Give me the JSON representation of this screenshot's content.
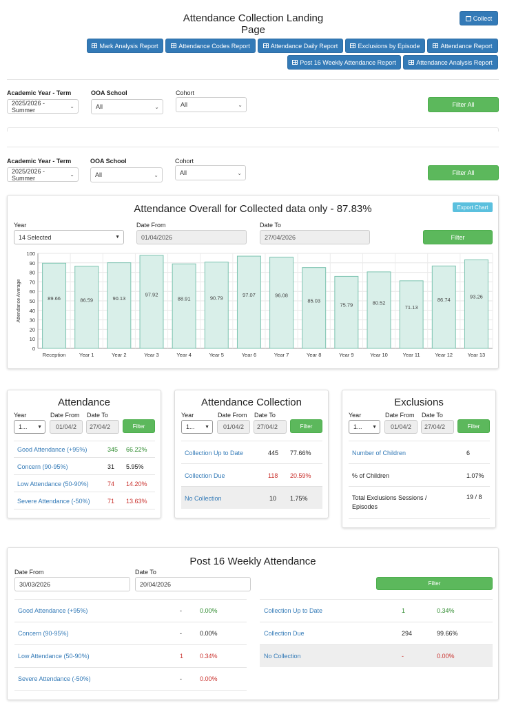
{
  "header": {
    "title_line1": "Attendance Collection Landing",
    "title_line2": "Page",
    "collect_label": "Collect",
    "reports": [
      "Mark Analysis Report",
      "Attendance Codes Report",
      "Attendance Daily Report",
      "Exclusions by Episode",
      "Attendance Report",
      "Post 16 Weekly Attendance Report",
      "Attendance Analysis Report"
    ]
  },
  "filters": [
    {
      "academic_label": "Academic Year - Term",
      "academic_value": "2025/2026 - Summer",
      "ooa_label": "OOA School",
      "ooa_value": "All",
      "cohort_label": "Cohort",
      "cohort_value": "All",
      "filter_all_label": "Filter All"
    },
    {
      "academic_label": "Academic Year - Term",
      "academic_value": "2025/2026 - Summer",
      "ooa_label": "OOA School",
      "ooa_value": "All",
      "cohort_label": "Cohort",
      "cohort_value": "All",
      "filter_all_label": "Filter All"
    }
  ],
  "overall": {
    "title": "Attendance Overall for Collected data only - 87.83%",
    "export_label": "Export Chart",
    "year_label": "Year",
    "year_value": "14 Selected",
    "date_from_label": "Date From",
    "date_from_value": "01/04/2026",
    "date_to_label": "Date To",
    "date_to_value": "27/04/2026",
    "filter_label": "Filter"
  },
  "chart_data": {
    "type": "bar",
    "categories": [
      "Reception",
      "Year 1",
      "Year 2",
      "Year 3",
      "Year 4",
      "Year 5",
      "Year 6",
      "Year 7",
      "Year 8",
      "Year 9",
      "Year 10",
      "Year 11",
      "Year 12",
      "Year 13"
    ],
    "values": [
      89.66,
      86.59,
      90.13,
      97.92,
      88.91,
      90.79,
      97.07,
      96.08,
      85.03,
      75.79,
      80.52,
      71.13,
      86.74,
      93.26
    ],
    "value_labels": [
      "89.66",
      "86.59",
      "90.13",
      "97.92",
      "88.91",
      "90.79",
      "97.07",
      "96.08",
      "85.03",
      "75.79",
      "80.52",
      "71.13",
      "86.74",
      "93.26"
    ],
    "ylabel": "Attendance Average",
    "ylim": [
      0,
      100
    ],
    "yticks": [
      "0",
      "10",
      "20",
      "30",
      "40",
      "50",
      "60",
      "70",
      "80",
      "90",
      "100"
    ],
    "grid": true,
    "bar_fill": "#d9efe9",
    "bar_stroke": "#7cc3b0"
  },
  "attendance": {
    "title": "Attendance",
    "year_label": "Year",
    "year_value": "1...",
    "date_from_label": "Date From",
    "date_from_value": "01/04/2",
    "date_to_label": "Date To",
    "date_to_value": "27/04/2",
    "filter_label": "Filter",
    "rows": [
      {
        "label": "Good Attendance (+95%)",
        "count": "345",
        "pct": "66.22%"
      },
      {
        "label": "Concern (90-95%)",
        "count": "31",
        "pct": "5.95%"
      },
      {
        "label": "Low Attendance (50-90%)",
        "count": "74",
        "pct": "14.20%"
      },
      {
        "label": "Severe Attendance (-50%)",
        "count": "71",
        "pct": "13.63%"
      }
    ]
  },
  "collection": {
    "title": "Attendance Collection",
    "year_label": "Year",
    "year_value": "1...",
    "date_from_label": "Date From",
    "date_from_value": "01/04/2",
    "date_to_label": "Date To",
    "date_to_value": "27/04/2",
    "filter_label": "Filter",
    "rows": [
      {
        "label": "Collection Up to Date",
        "count": "445",
        "pct": "77.66%"
      },
      {
        "label": "Collection Due",
        "count": "118",
        "pct": "20.59%"
      },
      {
        "label": "No Collection",
        "count": "10",
        "pct": "1.75%"
      }
    ]
  },
  "exclusions": {
    "title": "Exclusions",
    "year_label": "Year",
    "year_value": "1...",
    "date_from_label": "Date From",
    "date_from_value": "01/04/2",
    "date_to_label": "Date To",
    "date_to_value": "27/04/2",
    "filter_label": "Filter",
    "rows": [
      {
        "label": "Number of Children",
        "value": "6"
      },
      {
        "label": "% of Children",
        "value": "1.07%"
      },
      {
        "label": "Total Exclusions Sessions / Episodes",
        "value": "19 / 8"
      }
    ]
  },
  "post16": {
    "title": "Post 16 Weekly Attendance",
    "date_from_label": "Date From",
    "date_from_value": "30/03/2026",
    "date_to_label": "Date To",
    "date_to_value": "20/04/2026",
    "filter_label": "Filter",
    "left_rows": [
      {
        "label": "Good Attendance (+95%)",
        "count": "-",
        "pct": "0.00%"
      },
      {
        "label": "Concern (90-95%)",
        "count": "-",
        "pct": "0.00%"
      },
      {
        "label": "Low Attendance (50-90%)",
        "count": "1",
        "pct": "0.34%"
      },
      {
        "label": "Severe Attendance (-50%)",
        "count": "-",
        "pct": "0.00%"
      }
    ],
    "right_rows": [
      {
        "label": "Collection Up to Date",
        "count": "1",
        "pct": "0.34%"
      },
      {
        "label": "Collection Due",
        "count": "294",
        "pct": "99.66%"
      },
      {
        "label": "No Collection",
        "count": "-",
        "pct": "0.00%"
      }
    ]
  }
}
